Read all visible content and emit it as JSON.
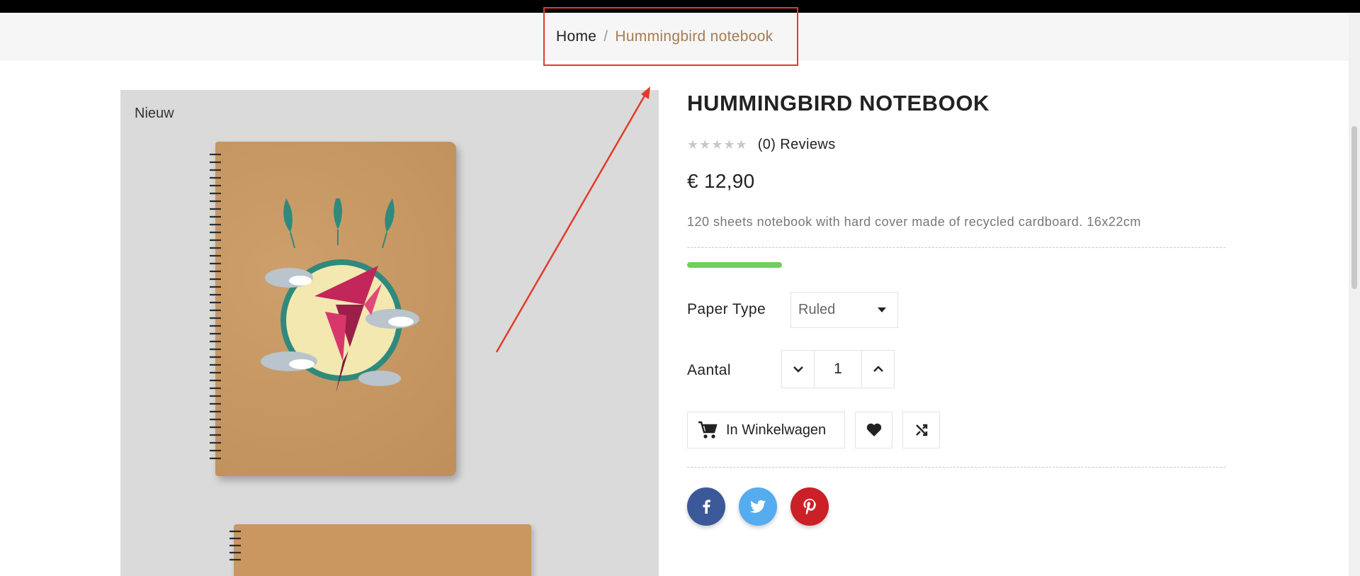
{
  "breadcrumb": {
    "home": "Home",
    "separator": "/",
    "current": "Hummingbird notebook"
  },
  "gallery": {
    "badge": "Nieuw"
  },
  "product": {
    "title": "HUMMINGBIRD NOTEBOOK",
    "rating": 0,
    "reviews": "(0) Reviews",
    "price": "€ 12,90",
    "description": "120 sheets notebook with hard cover made of recycled cardboard. 16x22cm",
    "stock_level": 0.22
  },
  "options": {
    "paper_label": "Paper Type",
    "paper_value": "Ruled",
    "qty_label": "Aantal",
    "qty_value": "1"
  },
  "actions": {
    "cart_label": "In Winkelwagen"
  },
  "icons": {
    "cart": "cart-icon",
    "wishlist": "heart-icon",
    "compare": "shuffle-icon",
    "facebook": "facebook-icon",
    "twitter": "twitter-icon",
    "pinterest": "pinterest-icon"
  },
  "colors": {
    "accent": "#a67c52",
    "stock": "#6fcf57",
    "annotation": "#e23b2a",
    "facebook": "#3b5998",
    "twitter": "#55acee",
    "pinterest": "#cb2027"
  }
}
